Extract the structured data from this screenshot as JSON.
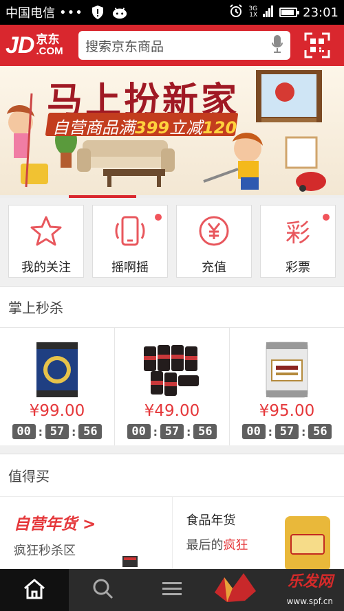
{
  "status_bar": {
    "carrier": "中国电信",
    "dots": "•••",
    "net_top": "3G",
    "net_bottom": "1X",
    "time": "23:01"
  },
  "header": {
    "logo_main": "JD",
    "logo_cn": "京东",
    "logo_com": ".COM",
    "search_placeholder": "搜索京东商品",
    "brand_color": "#d9272e"
  },
  "banner": {
    "headline": "马上扮新家",
    "promo_prefix": "自营商品满",
    "promo_amount": "399",
    "promo_mid": "立减",
    "promo_discount": "120",
    "active_slide": 2
  },
  "quick_entries": [
    {
      "label": "我的关注",
      "icon": "star-icon",
      "badge": false
    },
    {
      "label": "摇啊摇",
      "icon": "shake-phone-icon",
      "badge": true
    },
    {
      "label": "充值",
      "icon": "yuan-icon",
      "badge": false
    },
    {
      "label": "彩票",
      "icon": "lottery-icon",
      "badge": true
    }
  ],
  "seckill": {
    "title": "掌上秒杀",
    "items": [
      {
        "price": "¥99.00",
        "timer": [
          "00",
          "57",
          "56"
        ],
        "image": "beer-keg-blue"
      },
      {
        "price": "¥49.00",
        "timer": [
          "00",
          "57",
          "56"
        ],
        "image": "beer-cans-black"
      },
      {
        "price": "¥95.00",
        "timer": [
          "00",
          "57",
          "56"
        ],
        "image": "beer-keg-white"
      }
    ]
  },
  "worth_buying": {
    "title": "值得买",
    "left": {
      "title": "自营年货 >",
      "subtitle": "疯狂秒杀区"
    },
    "right": {
      "title": "食品年货",
      "subtitle_prefix": "最后的",
      "subtitle_highlight": "疯狂"
    }
  },
  "tabbar": {
    "tabs": [
      {
        "icon": "home-icon",
        "active": true
      },
      {
        "icon": "search-icon",
        "active": false
      },
      {
        "icon": "menu-icon",
        "active": false
      }
    ]
  },
  "watermark": {
    "text": "乐发网",
    "url": "www.spf.cn"
  }
}
